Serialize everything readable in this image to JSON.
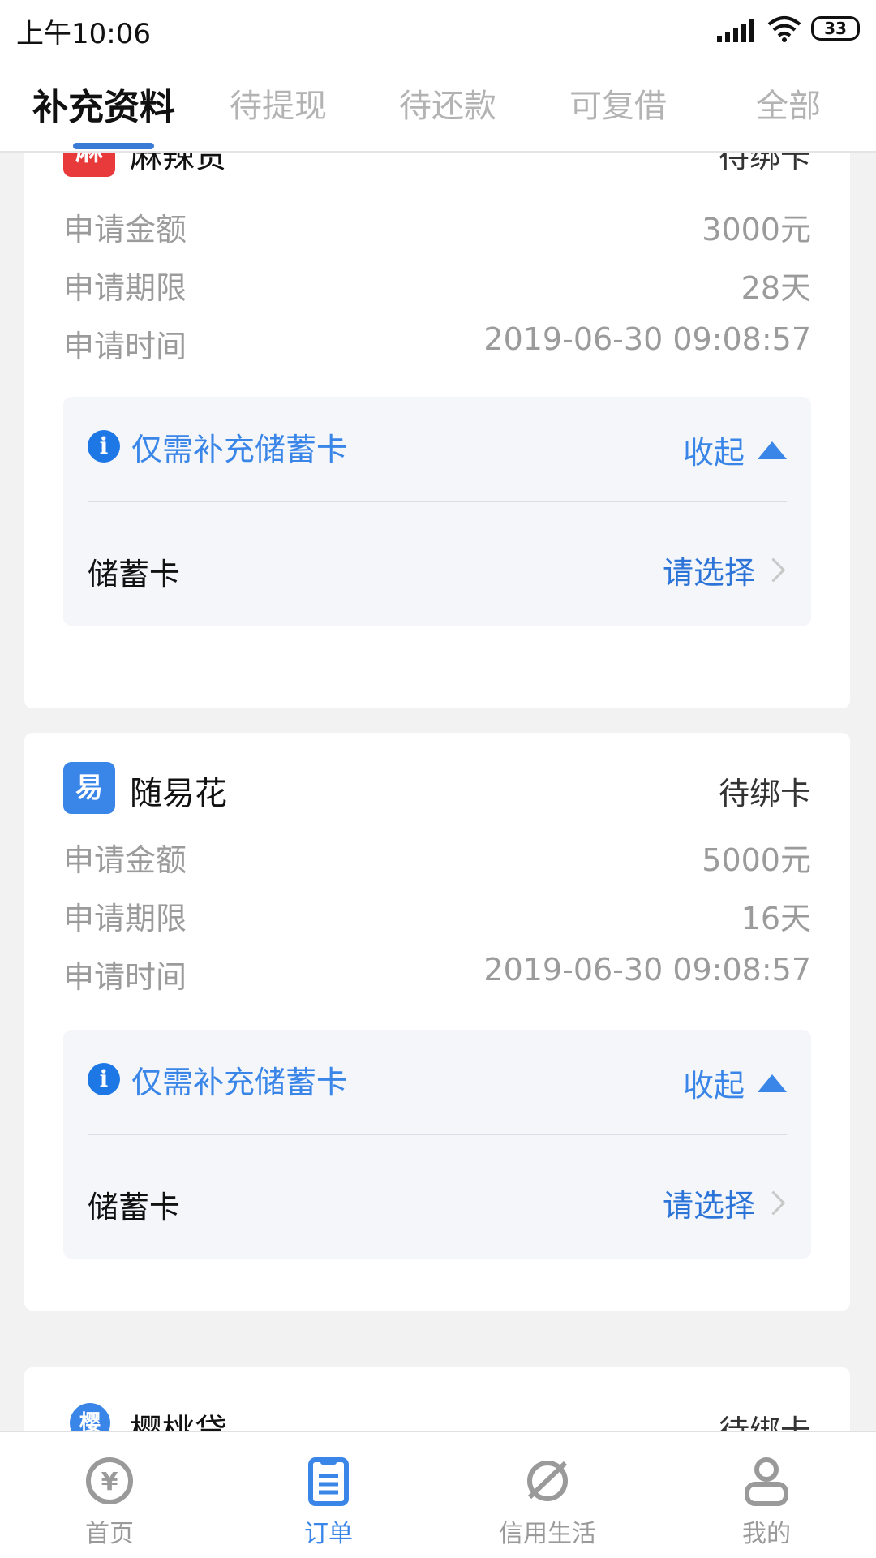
{
  "status_bar": {
    "time": "上午10:06",
    "battery": "33"
  },
  "tabs": [
    {
      "label": "补充资料",
      "active": true
    },
    {
      "label": "待提现"
    },
    {
      "label": "待还款"
    },
    {
      "label": "可复借"
    },
    {
      "label": "全部"
    }
  ],
  "orders": [
    {
      "name": "麻辣贷",
      "logo": "麻",
      "status": "待绑卡",
      "amount_label": "申请金额",
      "amount": "3000元",
      "term_label": "申请期限",
      "term": "28天",
      "time_label": "申请时间",
      "time": "2019-06-30 09:08:57",
      "notice": "仅需补充储蓄卡",
      "collapse": "收起",
      "field_label": "储蓄卡",
      "field_placeholder": "请选择"
    },
    {
      "name": "随易花",
      "logo": "易",
      "status": "待绑卡",
      "amount_label": "申请金额",
      "amount": "5000元",
      "term_label": "申请期限",
      "term": "16天",
      "time_label": "申请时间",
      "time": "2019-06-30 09:08:57",
      "notice": "仅需补充储蓄卡",
      "collapse": "收起",
      "field_label": "储蓄卡",
      "field_placeholder": "请选择"
    },
    {
      "name": "樱桃贷",
      "logo": "樱",
      "status": "待绑卡"
    }
  ],
  "bottom_nav": [
    {
      "label": "首页",
      "icon": "yen-icon"
    },
    {
      "label": "订单",
      "icon": "order-list-icon",
      "active": true
    },
    {
      "label": "信用生活",
      "icon": "planet-icon"
    },
    {
      "label": "我的",
      "icon": "user-icon"
    }
  ],
  "colors": {
    "accent": "#3a86e8",
    "indicator": "#3a7bd5",
    "logo_red": "#e8393b"
  }
}
